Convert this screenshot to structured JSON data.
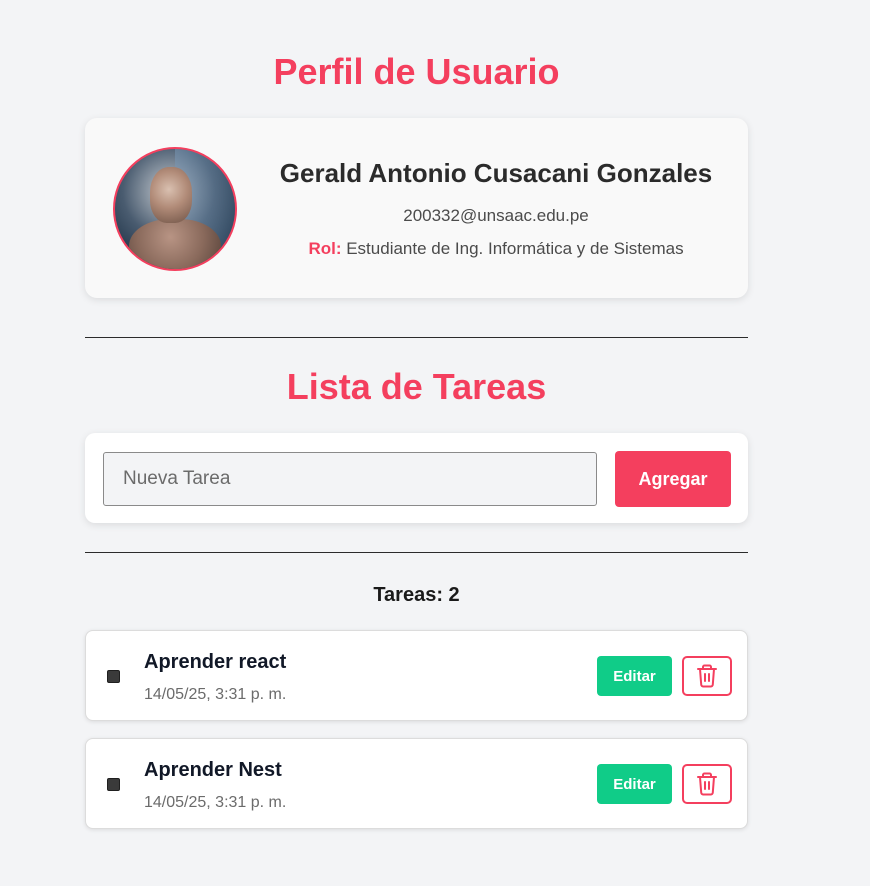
{
  "profile": {
    "heading": "Perfil de Usuario",
    "name": "Gerald Antonio Cusacani Gonzales",
    "email": "200332@unsaac.edu.pe",
    "role_label": "Rol:",
    "role_value": "Estudiante de Ing. Informática y de Sistemas"
  },
  "tasks": {
    "heading": "Lista de Tareas",
    "input_placeholder": "Nueva Tarea",
    "input_value": "",
    "add_label": "Agregar",
    "count_text": "Tareas: 2",
    "items": [
      {
        "title": "Aprender react",
        "date": "14/05/25, 3:31 p. m.",
        "edit_label": "Editar",
        "delete_icon": "trash-icon"
      },
      {
        "title": "Aprender Nest",
        "date": "14/05/25, 3:31 p. m.",
        "edit_label": "Editar",
        "delete_icon": "trash-icon"
      }
    ]
  },
  "colors": {
    "accent": "#f43f5e",
    "edit": "#10cc88",
    "background": "#f3f4f6"
  }
}
